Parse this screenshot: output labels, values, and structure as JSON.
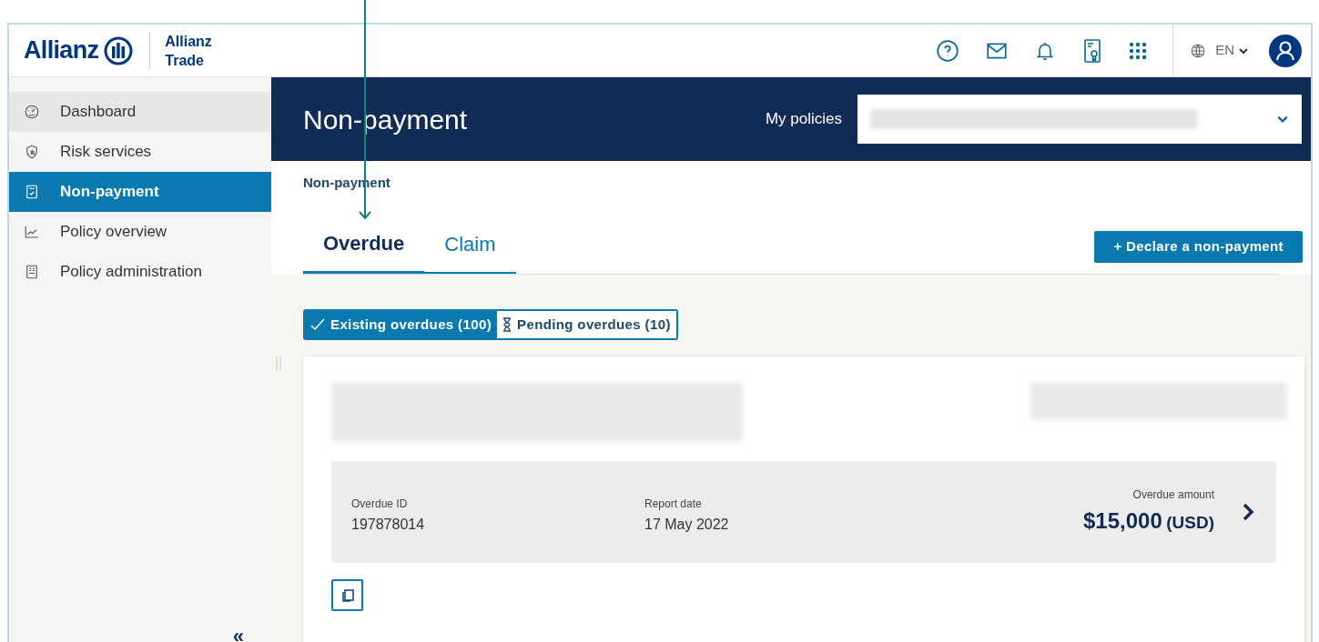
{
  "header": {
    "logo": "Allianz",
    "brand": [
      "Allianz",
      "Trade"
    ],
    "language": "EN"
  },
  "sidebar": {
    "items": [
      {
        "label": "Dashboard",
        "kind": "gauge",
        "selected": false,
        "hovered": true
      },
      {
        "label": "Risk services",
        "kind": "shield",
        "selected": false,
        "hovered": false
      },
      {
        "label": "Non-payment",
        "kind": "clipboard",
        "selected": true,
        "hovered": false
      },
      {
        "label": "Policy overview",
        "kind": "chart",
        "selected": false,
        "hovered": false
      },
      {
        "label": "Policy administration",
        "kind": "document",
        "selected": false,
        "hovered": false
      }
    ],
    "collapse": "«"
  },
  "banner": {
    "title": "Non-payment",
    "policies_label": "My policies"
  },
  "breadcrumb": "Non-payment",
  "tabs": [
    {
      "label": "Overdue",
      "selected": true
    },
    {
      "label": "Claim",
      "selected": false
    }
  ],
  "declare_button": "+ Declare a non-payment",
  "filters": [
    {
      "label": "Existing overdues (100)",
      "kind": "existing",
      "selected": true
    },
    {
      "label": "Pending overdues (10)",
      "kind": "pending",
      "selected": false
    }
  ],
  "overdue": {
    "fields": [
      {
        "label": "Overdue ID",
        "value": "197878014"
      },
      {
        "label": "Report date",
        "value": "17 May 2022"
      }
    ],
    "amount_label": "Overdue amount",
    "amount": "$15,000",
    "currency": "(USD)"
  }
}
